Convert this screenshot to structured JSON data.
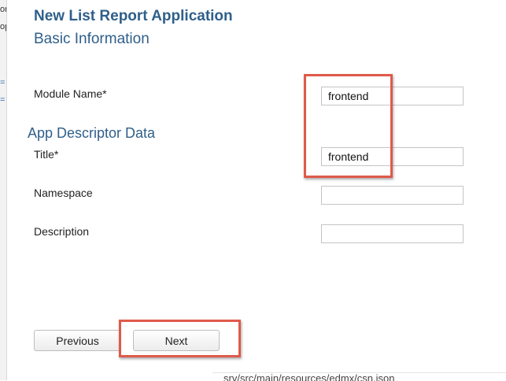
{
  "background": {
    "frag_1": "or",
    "frag_2": "op",
    "frag_3": "=",
    "frag_4": "=",
    "bottom_text": "srv/src/main/resources/edmx/csn.json"
  },
  "dialog": {
    "title": "New List Report Application",
    "basic_section": "Basic Information",
    "module_name_label": "Module Name*",
    "module_name_value": "frontend",
    "app_descriptor_section": "App Descriptor Data",
    "title_label": "Title*",
    "title_value": "frontend",
    "namespace_label": "Namespace",
    "namespace_value": "",
    "description_label": "Description",
    "description_value": ""
  },
  "buttons": {
    "previous": "Previous",
    "next": "Next"
  },
  "colors": {
    "accent": "#2f5f8a",
    "highlight": "#e05a4a"
  }
}
